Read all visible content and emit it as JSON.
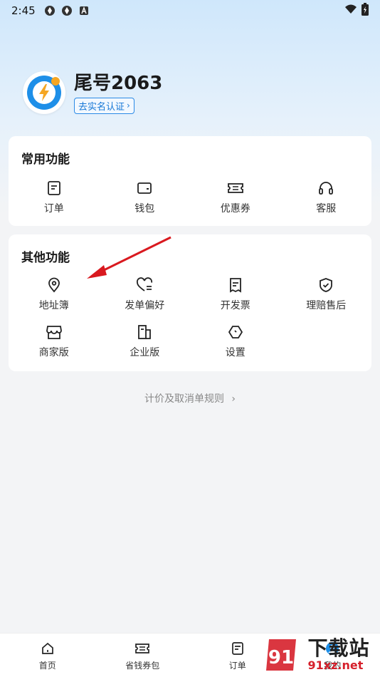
{
  "status_bar": {
    "time": "2:45"
  },
  "profile": {
    "username": "尾号2063",
    "verify_label": "去实名认证"
  },
  "common": {
    "title": "常用功能",
    "items": [
      {
        "label": "订单",
        "icon": "order-icon"
      },
      {
        "label": "钱包",
        "icon": "wallet-icon"
      },
      {
        "label": "优惠券",
        "icon": "coupon-icon"
      },
      {
        "label": "客服",
        "icon": "headset-icon"
      }
    ]
  },
  "other": {
    "title": "其他功能",
    "items": [
      {
        "label": "地址簿",
        "icon": "location-pin-icon"
      },
      {
        "label": "发单偏好",
        "icon": "heart-list-icon"
      },
      {
        "label": "开发票",
        "icon": "invoice-icon"
      },
      {
        "label": "理赔售后",
        "icon": "shield-check-icon"
      },
      {
        "label": "商家版",
        "icon": "store-icon"
      },
      {
        "label": "企业版",
        "icon": "building-icon"
      },
      {
        "label": "设置",
        "icon": "settings-icon"
      }
    ]
  },
  "rules_link": "计价及取消单规则",
  "bottom_nav": [
    {
      "label": "首页",
      "icon": "home-icon"
    },
    {
      "label": "省钱券包",
      "icon": "coupon-pack-icon"
    },
    {
      "label": "订单",
      "icon": "order-icon"
    },
    {
      "label": "我的",
      "icon": "profile-icon"
    }
  ],
  "watermark": {
    "brand": "下载站",
    "site": "91xz.net",
    "logo_text": "91"
  },
  "colors": {
    "accent": "#1677d6",
    "annotation_arrow": "#d9191f",
    "watermark_red": "#d6202b"
  }
}
